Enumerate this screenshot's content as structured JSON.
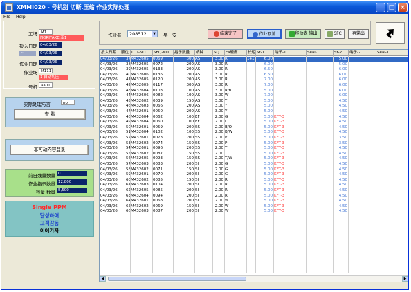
{
  "window": {
    "title": "XMMI020 - 号机别 切断.压缩 作业实际处理"
  },
  "menu": {
    "file": "File",
    "help": "Help"
  },
  "info": {
    "kouba_label": "工场",
    "kouba_value": "M1",
    "kouba_desc": "NORITAKE 亚1",
    "input_date_label": "投入日期",
    "input_date": "04/03/26",
    "input_date2": "04/03/26",
    "work_date_label": "作业日期",
    "work_date": "04/03/26",
    "work_place_label": "作业场",
    "work_place": "M111",
    "work_place_desc": "1 自动切压",
    "machine_label": "号机",
    "machine_value": "aa01"
  },
  "query": {
    "label": "实际处理与否",
    "value": "no",
    "view_button": "查 看"
  },
  "modify": {
    "button": "非可动内容登录"
  },
  "counts": {
    "prev_label": "前日残量数量",
    "prev_value": "0",
    "order_label": "作业指示数量",
    "order_value": "12,800",
    "remain_label": "残量 数量",
    "remain_value": "5,500"
  },
  "promo": {
    "line1": "Single PPM",
    "line2": "달성하여",
    "line3": "고객감동",
    "line4": "이어가자"
  },
  "topbar": {
    "worker_label": "作业者:",
    "worker_id": "208512",
    "worker_name": "吴士安",
    "finish_btn": "结束完了",
    "cancel_btn": "作业取消",
    "move_btn": "移动表 输出",
    "sfc_btn": "SFC",
    "reprint_btn": "再输出"
  },
  "grid": {
    "headers": [
      "投入日期",
      "顺位",
      "LOT-NO",
      "SEQ-NO",
      "指示数量",
      "纸种",
      "SQ",
      "ca硬度",
      "长短",
      "St-1",
      "端子-1",
      "Seal-1",
      "St-2",
      "端子-2",
      "Seal-1"
    ],
    "rows": [
      [
        "04/03/26",
        "37",
        "M432605",
        "0069",
        "300",
        "AS",
        "3.00",
        "R",
        "1415",
        "6.00",
        "",
        "",
        "5.00",
        ""
      ],
      [
        "04/03/26",
        "38",
        "M432605",
        "0072",
        "200",
        "AS",
        "3.00",
        "R",
        "",
        "6.00",
        "",
        "",
        "5.00",
        ""
      ],
      [
        "04/03/26",
        "39",
        "M432605",
        "0133",
        "200",
        "AS",
        "3.00",
        "R",
        "",
        "6.50",
        "",
        "",
        "6.00",
        ""
      ],
      [
        "04/03/26",
        "40",
        "M432606",
        "0136",
        "200",
        "AS",
        "3.00",
        "R",
        "",
        "6.50",
        "",
        "",
        "6.00",
        ""
      ],
      [
        "04/03/26",
        "41",
        "M432605",
        "0120",
        "200",
        "AS",
        "3.00",
        "R",
        "",
        "7.00",
        "",
        "",
        "6.00",
        ""
      ],
      [
        "04/03/26",
        "42",
        "M432605",
        "0117",
        "300",
        "AS",
        "3.00",
        "R",
        "",
        "7.00",
        "",
        "",
        "6.00",
        ""
      ],
      [
        "04/03/26",
        "43",
        "M432604",
        "0103",
        "100",
        "AS",
        "3.00",
        "R/B",
        "",
        "5.00",
        "",
        "",
        "6.00",
        ""
      ],
      [
        "04/03/26",
        "44",
        "M432606",
        "0082",
        "100",
        "AS",
        "3.00",
        "W",
        "",
        "7.00",
        "",
        "",
        "6.00",
        ""
      ],
      [
        "04/03/26",
        "45",
        "M432602",
        "0039",
        "150",
        "AS",
        "3.00",
        "Y",
        "",
        "5.00",
        "",
        "",
        "4.50",
        ""
      ],
      [
        "04/03/26",
        "46",
        "M432603",
        "0066",
        "200",
        "AS",
        "3.00",
        "Y",
        "",
        "5.00",
        "",
        "",
        "4.50",
        ""
      ],
      [
        "04/03/26",
        "47",
        "M432601",
        "0050",
        "200",
        "AS",
        "3.00",
        "Y",
        "",
        "5.00",
        "",
        "",
        "4.50",
        ""
      ],
      [
        "04/03/26",
        "48",
        "M432604",
        "0062",
        "100",
        "EF",
        "2.00",
        "G",
        "",
        "5.00",
        "KFT-3",
        "",
        "4.50",
        ""
      ],
      [
        "04/03/26",
        "49",
        "M432604",
        "0060",
        "100",
        "EF",
        "2.00",
        "L",
        "",
        "5.00",
        "KFT-3",
        "",
        "4.50",
        ""
      ],
      [
        "04/03/26",
        "50",
        "M432601",
        "0059",
        "200",
        "SS",
        "2.00",
        "B/O",
        "",
        "5.00",
        "KFT-3",
        "",
        "4.50",
        ""
      ],
      [
        "04/03/26",
        "51",
        "M432604",
        "0102",
        "100",
        "SS",
        "2.00",
        "B/W",
        "",
        "5.00",
        "KFT-3",
        "",
        "4.50",
        ""
      ],
      [
        "04/03/26",
        "52",
        "M432601",
        "0073",
        "200",
        "SS",
        "2.00",
        "P",
        "",
        "5.00",
        "KFT-3",
        "",
        "3.50",
        ""
      ],
      [
        "04/03/26",
        "53",
        "M432602",
        "0074",
        "150",
        "SS",
        "2.00",
        "P",
        "",
        "5.00",
        "KFT-3",
        "",
        "3.50",
        ""
      ],
      [
        "04/03/26",
        "54",
        "M432601",
        "0096",
        "200",
        "SS",
        "2.00",
        "T",
        "",
        "5.00",
        "KFT-3",
        "",
        "4.50",
        ""
      ],
      [
        "04/03/26",
        "55",
        "M432602",
        "0087",
        "150",
        "SS",
        "2.00",
        "T",
        "",
        "5.00",
        "KFT-3",
        "",
        "4.50",
        ""
      ],
      [
        "04/03/26",
        "56",
        "M432605",
        "0093",
        "150",
        "SS",
        "2.00",
        "T/W",
        "",
        "5.00",
        "KFT-3",
        "",
        "4.50",
        ""
      ],
      [
        "04/03/26",
        "57",
        "M432603",
        "0083",
        "200",
        "SI",
        "2.00",
        "G",
        "",
        "5.00",
        "KFT-3",
        "",
        "4.50",
        ""
      ],
      [
        "04/03/26",
        "58",
        "M432602",
        "0071",
        "150",
        "SI",
        "2.00",
        "G",
        "",
        "5.00",
        "KFT-3",
        "",
        "4.50",
        ""
      ],
      [
        "04/03/26",
        "59",
        "M432601",
        "0070",
        "200",
        "SI",
        "2.00",
        "G",
        "",
        "5.00",
        "KFT-3",
        "",
        "4.50",
        ""
      ],
      [
        "04/03/26",
        "60",
        "M432602",
        "0085",
        "150",
        "SI",
        "2.00",
        "R",
        "",
        "5.00",
        "KFT-3",
        "",
        "4.50",
        ""
      ],
      [
        "04/03/26",
        "61",
        "M432603",
        "0104",
        "200",
        "SI",
        "2.00",
        "R",
        "",
        "5.00",
        "KFT-3",
        "",
        "4.50",
        ""
      ],
      [
        "04/03/26",
        "62",
        "M432605",
        "0085",
        "200",
        "SI",
        "2.00",
        "R",
        "",
        "5.00",
        "KFT-3",
        "",
        "4.50",
        ""
      ],
      [
        "04/03/26",
        "63",
        "M432604",
        "0094",
        "200",
        "SI",
        "2.00",
        "R",
        "",
        "5.00",
        "KFT-3",
        "",
        "4.50",
        ""
      ],
      [
        "04/03/26",
        "64",
        "M432601",
        "0068",
        "200",
        "SI",
        "2.00",
        "W",
        "",
        "5.00",
        "KFT-3",
        "",
        "4.50",
        ""
      ],
      [
        "04/03/26",
        "65",
        "M432602",
        "0069",
        "150",
        "SI",
        "2.00",
        "W",
        "",
        "5.00",
        "KFT-3",
        "",
        "4.50",
        ""
      ],
      [
        "04/03/26",
        "66",
        "M432603",
        "0087",
        "200",
        "SI",
        "2.00",
        "W",
        "",
        "5.00",
        "KFT-3",
        "",
        "4.50",
        ""
      ]
    ]
  },
  "colors": {
    "title_bar": "#0a58d8",
    "selected_row": "#316ac5",
    "navy_field": "#0a246a",
    "red_field": "#ff5b5b",
    "terminal_text": "#ff3333",
    "value_blue": "#4a7bd6"
  }
}
